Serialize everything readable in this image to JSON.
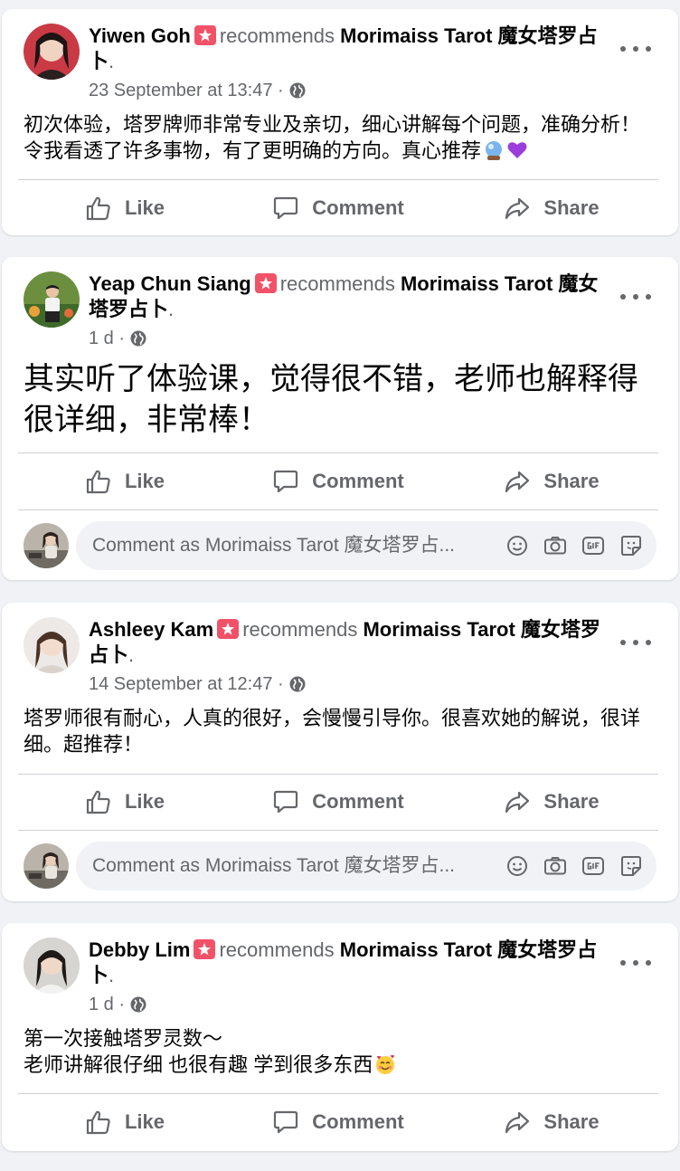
{
  "posts": [
    {
      "author": "Yiwen Goh",
      "verb": "recommends",
      "page": "Morimaiss Tarot 魔女塔罗占卜",
      "timestamp": "23 September at 13:47 ·",
      "text": "初次体验，塔罗牌师非常专业及亲切，细心讲解每个问题，准确分析！令我看透了许多事物，有了更明确的方向。真心推荐",
      "emojis": [
        "crystal-ball",
        "purple-heart"
      ],
      "has_comment_box": false
    },
    {
      "author": "Yeap Chun Siang",
      "verb": "recommends",
      "page": "Morimaiss Tarot 魔女塔罗占卜",
      "timestamp": "1 d ·",
      "text": "其实听了体验课，觉得很不错，老师也解释得很详细，非常棒！",
      "emojis": [],
      "has_comment_box": true
    },
    {
      "author": "Ashleey Kam",
      "verb": "recommends",
      "page": "Morimaiss Tarot 魔女塔罗占卜",
      "timestamp": "14 September at 12:47 ·",
      "text": "塔罗师很有耐心，人真的很好，会慢慢引导你。很喜欢她的解说，很详细。超推荐！",
      "emojis": [],
      "has_comment_box": true
    },
    {
      "author": "Debby Lim",
      "verb": "recommends",
      "page": "Morimaiss Tarot 魔女塔罗占卜",
      "timestamp": "1 d ·",
      "text": "第一次接触塔罗灵数～\n老师讲解很仔细 也很有趣 学到很多东西",
      "emojis": [
        "smiling-face-with-hearts"
      ],
      "has_comment_box": false
    }
  ],
  "actions": {
    "like": "Like",
    "comment": "Comment",
    "share": "Share"
  },
  "comment_placeholder": "Comment as Morimaiss Tarot 魔女塔罗占...",
  "colors": {
    "background": "#f0f2f5",
    "secondary_text": "#65676b",
    "badge": "#f25268"
  }
}
